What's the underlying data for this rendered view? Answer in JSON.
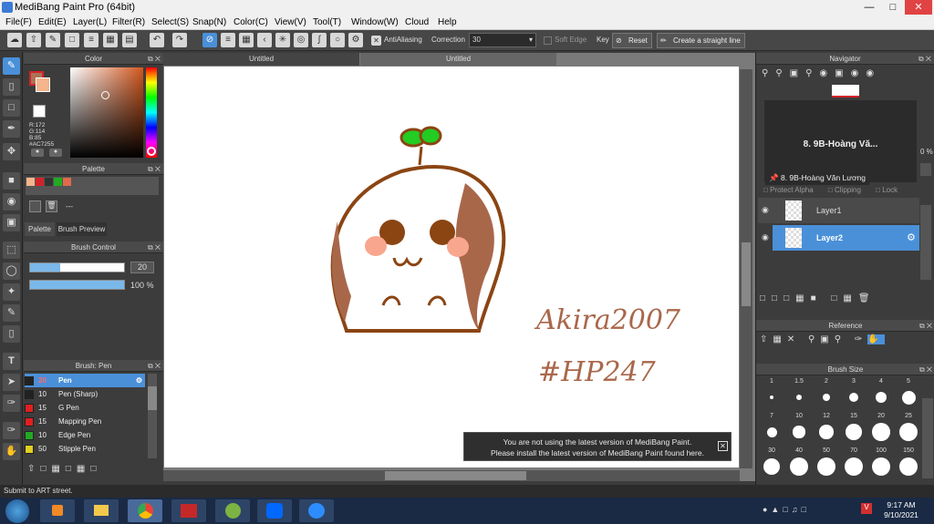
{
  "window": {
    "title": "MediBang Paint Pro (64bit)"
  },
  "menu": [
    "File(F)",
    "Edit(E)",
    "Layer(L)",
    "Filter(R)",
    "Select(S)",
    "Snap(N)",
    "Color(C)",
    "View(V)",
    "Tool(T)",
    "Window(W)",
    "Cloud",
    "Help"
  ],
  "toolbar": {
    "antialiasing": "AntiAliasing",
    "correction_label": "Correction",
    "correction_value": "30",
    "soft_edge": "Soft Edge",
    "key": "Key",
    "reset": "Reset",
    "straight_line": "Create a straight line"
  },
  "tabs": [
    "Untitled",
    "Untitled"
  ],
  "color_panel": {
    "title": "Color",
    "r": "R:172",
    "g": "G:114",
    "b": "B:85",
    "hex": "#AC7255",
    "fg": "#ac7255",
    "bg": "#ffffff"
  },
  "palette_panel": {
    "title": "Palette",
    "colors": [
      "#f4b48c",
      "#d2232a",
      "#333333",
      "#22aa22",
      "#e06a4a"
    ],
    "dash": "---",
    "tab1": "Palette",
    "tab2": "Brush Preview"
  },
  "brush_control": {
    "title": "Brush Control",
    "size": "20",
    "opacity": "100 %",
    "size_fill": 0.32,
    "opacity_fill": 1.0
  },
  "brush_list": {
    "title": "Brush: Pen",
    "items": [
      {
        "size": "20",
        "name": "Pen",
        "color": "#222222"
      },
      {
        "size": "10",
        "name": "Pen (Sharp)",
        "color": "#222222"
      },
      {
        "size": "15",
        "name": "G Pen",
        "color": "#e02020"
      },
      {
        "size": "15",
        "name": "Mapping Pen",
        "color": "#e02020"
      },
      {
        "size": "10",
        "name": "Edge Pen",
        "color": "#22aa22"
      },
      {
        "size": "50",
        "name": "Stipple Pen",
        "color": "#e0d020"
      }
    ]
  },
  "navigator": {
    "title": "Navigator"
  },
  "tooltip": {
    "heading": "8. 9B-Hoàng Vă...",
    "full": "8. 9B-Hoàng Văn Lương"
  },
  "layers": {
    "protect_alpha": "Protect Alpha",
    "clipping": "Clipping",
    "lock": "Lock",
    "opacity_pct": "0 %",
    "items": [
      "Layer1",
      "Layer2"
    ]
  },
  "reference": {
    "title": "Reference"
  },
  "brush_size": {
    "title": "Brush Size",
    "rows": [
      [
        "1",
        "1.5",
        "2",
        "3",
        "4",
        "5"
      ],
      [
        "7",
        "10",
        "12",
        "15",
        "20",
        "25"
      ],
      [
        "30",
        "40",
        "50",
        "70",
        "100",
        "150"
      ]
    ]
  },
  "drawing": {
    "sig1": "Akira2007",
    "sig2": "#HP247"
  },
  "notice": {
    "line1": "You are not using the latest version of MediBang Paint.",
    "line2": "Please install the latest version of MediBang Paint found here."
  },
  "status": "Submit to ART street.",
  "taskbar": {
    "time": "9:17 AM",
    "date": "9/10/2021",
    "apps": [
      "media-player",
      "file-explorer",
      "chrome",
      "bandicam",
      "launcher",
      "zalo",
      "zoom"
    ]
  }
}
